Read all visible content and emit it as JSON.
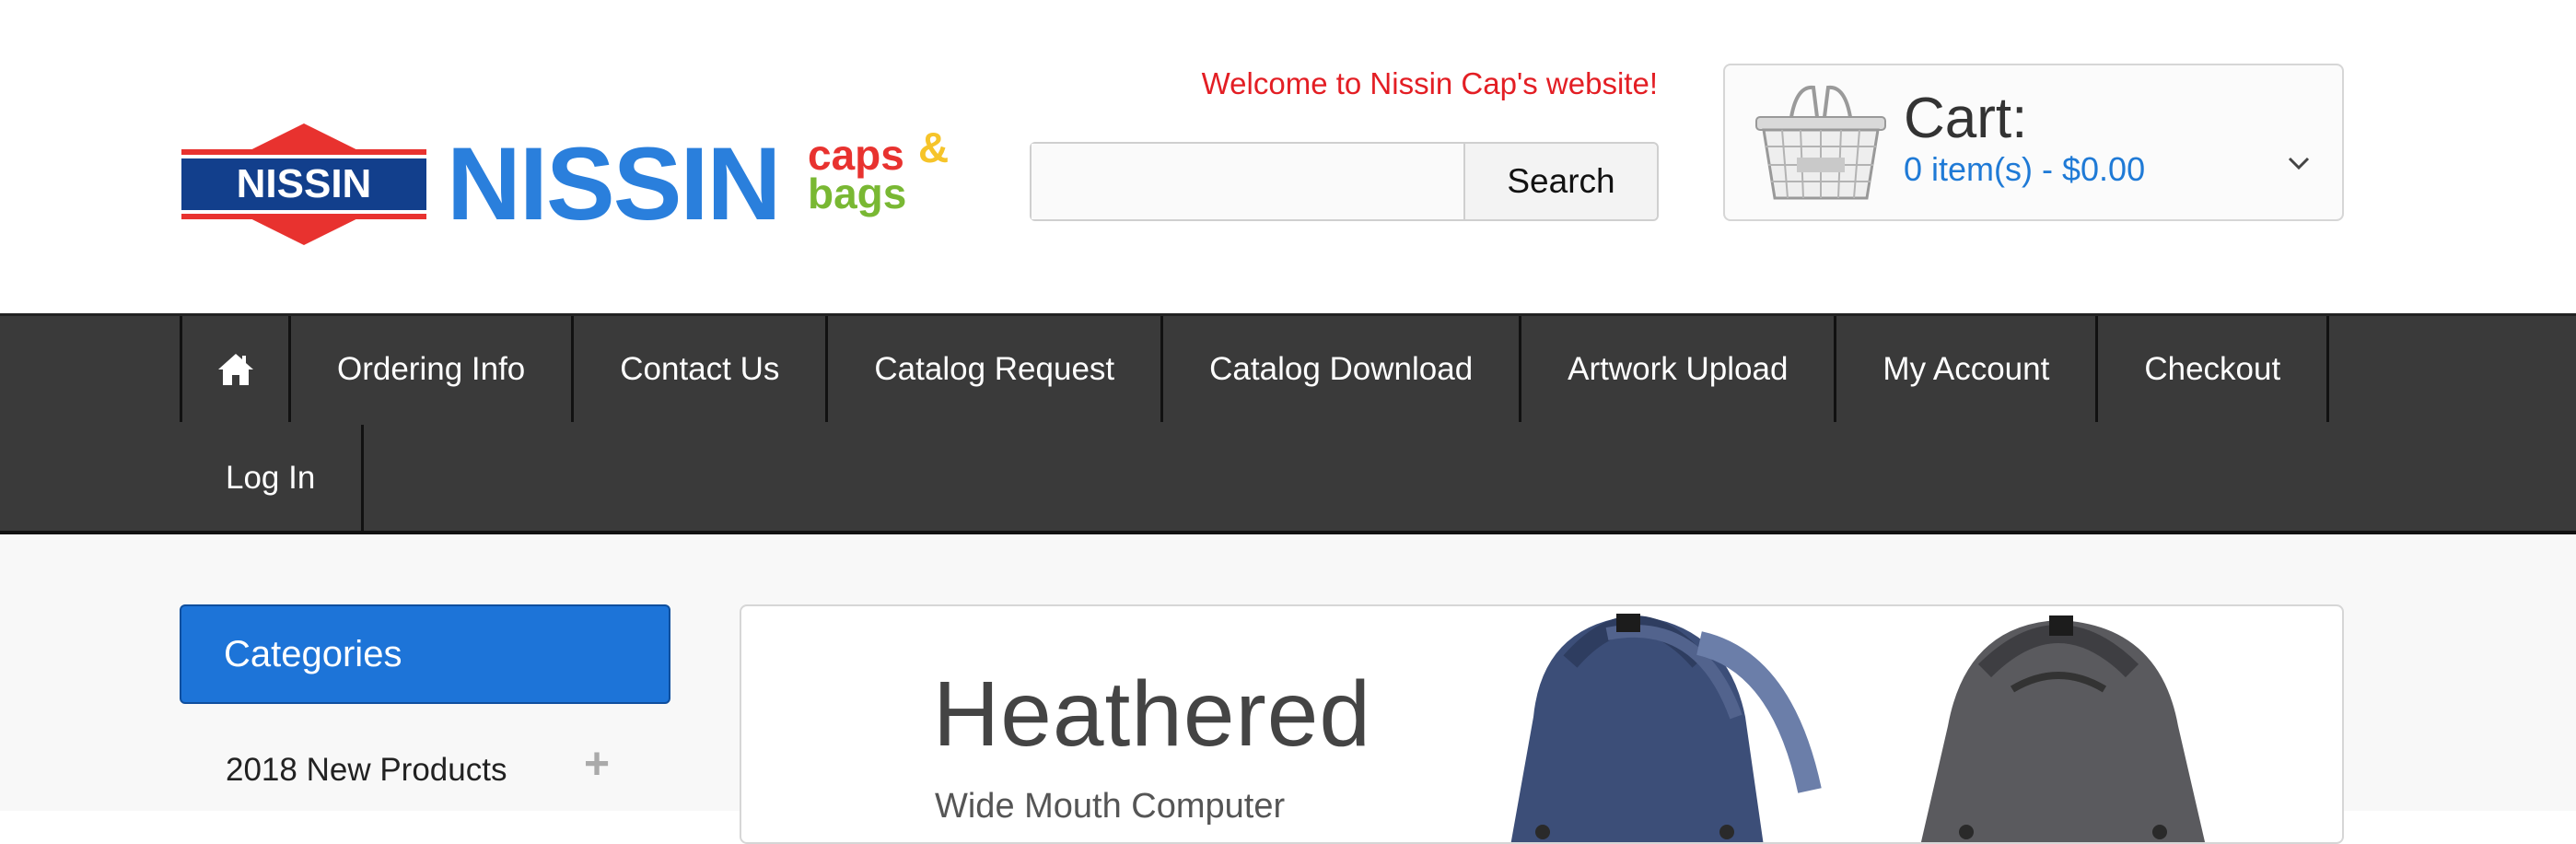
{
  "header": {
    "logo_word": "NISSIN",
    "logo_badge": "NISSIN",
    "logo_caps": "caps",
    "logo_amp": "&",
    "logo_bags": "bags",
    "welcome": "Welcome to Nissin Cap's website!",
    "search": {
      "placeholder": "",
      "value": "",
      "button_label": "Search"
    },
    "cart": {
      "title": "Cart:",
      "summary": "0 item(s) - $0.00",
      "icon": "basket-icon"
    }
  },
  "nav": {
    "home_icon": "home-icon",
    "items": [
      {
        "label": "Ordering Info"
      },
      {
        "label": "Contact Us"
      },
      {
        "label": "Catalog Request"
      },
      {
        "label": "Catalog Download"
      },
      {
        "label": "Artwork Upload"
      },
      {
        "label": "My Account"
      },
      {
        "label": "Checkout"
      },
      {
        "label": "Log In"
      }
    ]
  },
  "sidebar": {
    "heading": "Categories",
    "items": [
      {
        "label": "2018 New Products",
        "expander": "+"
      }
    ]
  },
  "banner": {
    "title": "Heathered",
    "subtitle": "Wide Mouth Computer"
  },
  "colors": {
    "brand_blue": "#2a7fdc",
    "welcome_red": "#e31e24",
    "nav_bg": "#3a3a3a",
    "category_blue": "#1d74d8"
  }
}
